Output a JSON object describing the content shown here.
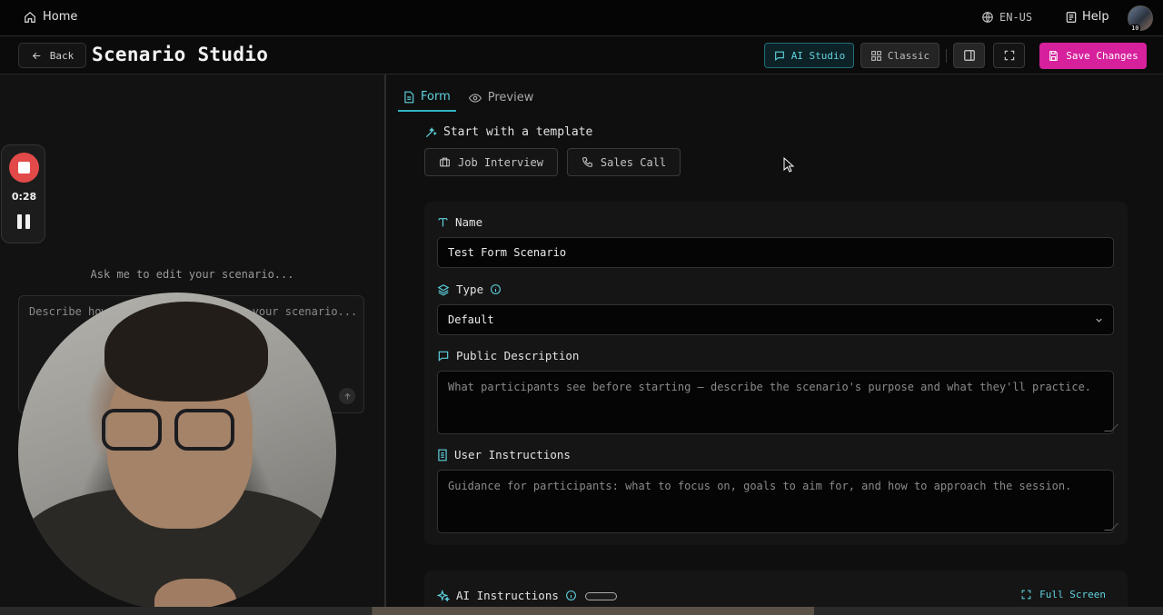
{
  "topbar": {
    "home_label": "Home",
    "language": "EN-US",
    "help_label": "Help",
    "avatar_badge": "10"
  },
  "header": {
    "back_label": "Back",
    "title": "Scenario Studio",
    "ai_studio_label": "AI Studio",
    "classic_label": "Classic",
    "save_label": "Save Changes"
  },
  "recorder": {
    "elapsed": "0:28"
  },
  "chat": {
    "prompt": "Ask me to edit your scenario...",
    "placeholder": "Describe how you'd like to change your scenario..."
  },
  "tabs": [
    {
      "label": "Form",
      "active": true
    },
    {
      "label": "Preview",
      "active": false
    }
  ],
  "templates": {
    "label": "Start with a template",
    "items": [
      "Job Interview",
      "Sales Call"
    ]
  },
  "form": {
    "name": {
      "label": "Name",
      "value": "Test Form Scenario"
    },
    "type": {
      "label": "Type",
      "value": "Default"
    },
    "public_description": {
      "label": "Public Description",
      "placeholder": "What participants see before starting — describe the scenario's purpose and what they'll practice."
    },
    "user_instructions": {
      "label": "User Instructions",
      "placeholder": "Guidance for participants: what to focus on, goals to aim for, and how to approach the session."
    }
  },
  "ai_instructions": {
    "label": "AI Instructions",
    "full_screen_label": "Full Screen"
  },
  "colors": {
    "accent": "#2fb3c0",
    "save": "#d6209c",
    "record": "#e24a4a"
  }
}
